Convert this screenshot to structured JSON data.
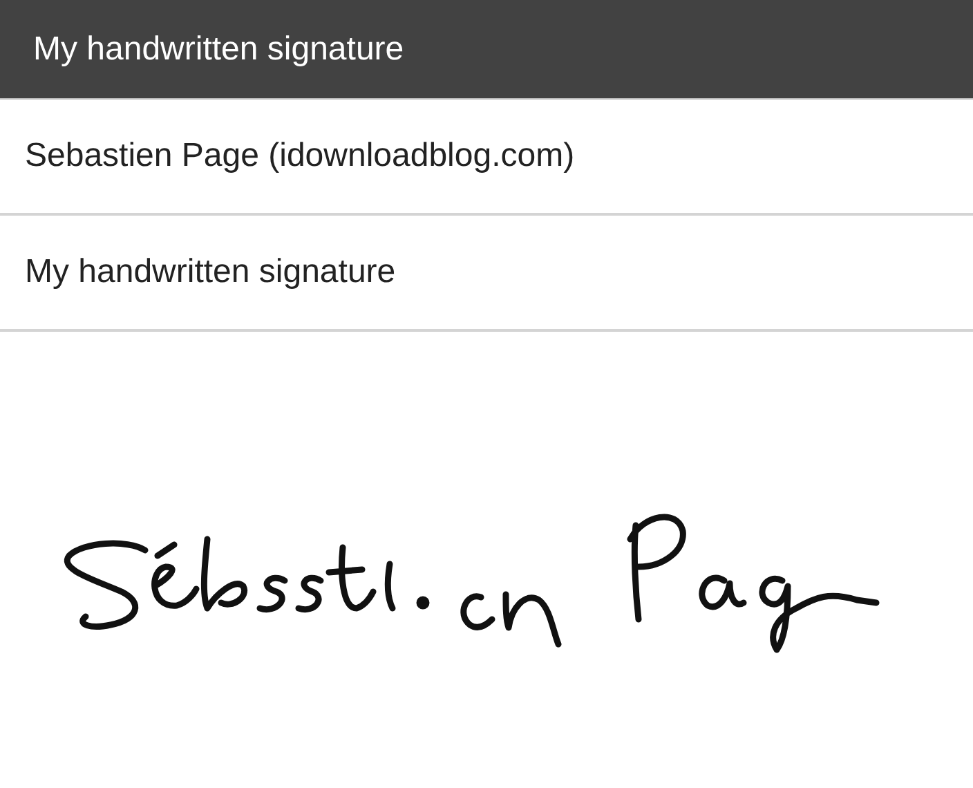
{
  "header": {
    "title": "My handwritten signature"
  },
  "rows": [
    {
      "label": "Sebastien Page (idownloadblog.com)"
    },
    {
      "label": "My handwritten signature"
    }
  ]
}
